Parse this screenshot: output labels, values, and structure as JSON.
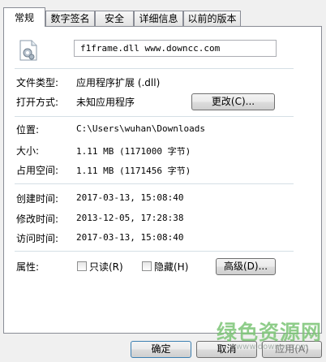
{
  "tabs": [
    "常规",
    "数字签名",
    "安全",
    "详细信息",
    "以前的版本"
  ],
  "file_name": "f1frame.dll  www.downcc.com",
  "fields": {
    "type_label": "文件类型:",
    "type_value": "应用程序扩展 (.dll)",
    "opens_label": "打开方式:",
    "opens_value": "未知应用程序",
    "change_button": "更改(C)...",
    "location_label": "位置:",
    "location_value": "C:\\Users\\wuhan\\Downloads",
    "size_label": "大小:",
    "size_value": "1.11 MB (1171000 字节)",
    "disk_label": "占用空间:",
    "disk_value": "1.11 MB (1171456 字节)",
    "created_label": "创建时间:",
    "created_value": "2017-03-13, 15:08:40",
    "modified_label": "修改时间:",
    "modified_value": "2013-12-05, 17:28:38",
    "accessed_label": "访问时间:",
    "accessed_value": "2017-03-13, 15:08:40",
    "attributes_label": "属性:",
    "readonly_label": "只读(R)",
    "hidden_label": "隐藏(H)",
    "advanced_button": "高级(D)..."
  },
  "buttons": {
    "ok": "确定",
    "cancel": "取消",
    "apply": "应用(A)"
  },
  "watermark": {
    "text": "绿色资源网",
    "url": "www.downcc.com"
  },
  "colors": {
    "watermark": "#7cc576",
    "tab_border": "#898c95"
  }
}
